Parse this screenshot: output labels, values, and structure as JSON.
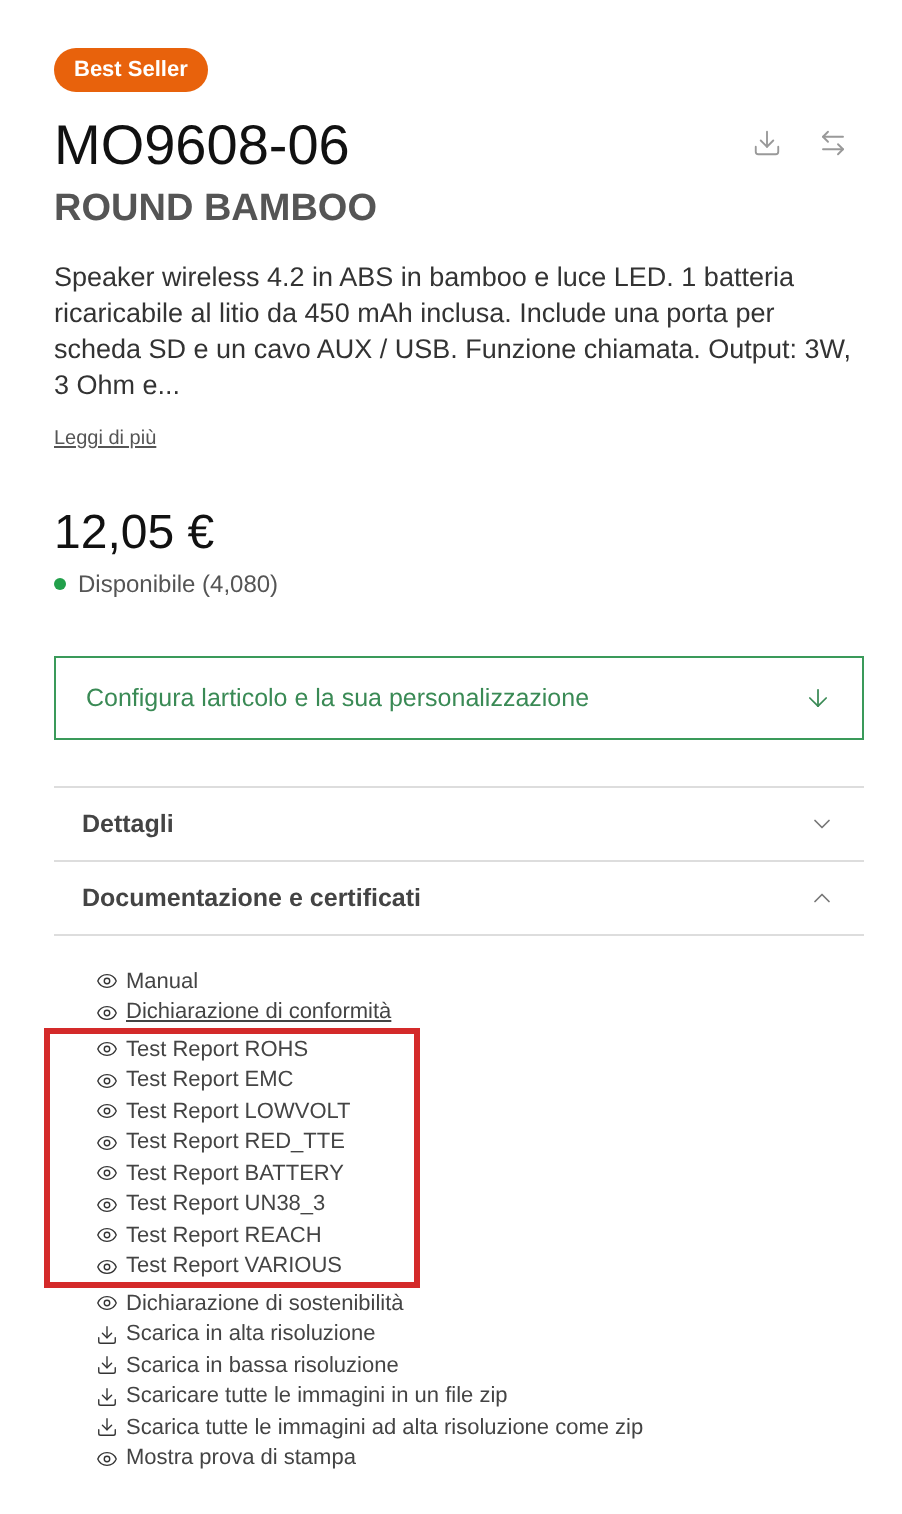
{
  "badge": "Best Seller",
  "product": {
    "code": "MO9608-06",
    "name": "ROUND BAMBOO",
    "description": "Speaker wireless 4.2 in ABS in bamboo e luce LED. 1 batteria ricaricabile al litio da 450 mAh inclusa. Include una porta per scheda SD e un cavo AUX / USB. Funzione chiamata. Output: 3W, 3 Ohm e...",
    "read_more": "Leggi di più"
  },
  "price": "12,05 €",
  "availability": {
    "text": "Disponibile (4,080)",
    "color": "#22a04b"
  },
  "configure": "Configura larticolo e la sua personalizzazione",
  "sections": [
    {
      "title": "Dettagli",
      "expanded": false
    },
    {
      "title": "Documentazione e certificati",
      "expanded": true
    }
  ],
  "document_groups": [
    {
      "kind": "plain",
      "items": [
        {
          "kind": "view",
          "label": "Manual",
          "hovered": false
        },
        {
          "kind": "view",
          "label": "Dichiarazione di conformità",
          "hovered": true
        }
      ]
    },
    {
      "kind": "highlighted",
      "items": [
        {
          "kind": "view",
          "label": "Test Report ROHS",
          "hovered": false
        },
        {
          "kind": "view",
          "label": "Test Report EMC",
          "hovered": false
        },
        {
          "kind": "view",
          "label": "Test Report LOWVOLT",
          "hovered": false
        },
        {
          "kind": "view",
          "label": "Test Report RED_TTE",
          "hovered": false
        },
        {
          "kind": "view",
          "label": "Test Report BATTERY",
          "hovered": false
        },
        {
          "kind": "view",
          "label": "Test Report UN38_3",
          "hovered": false
        },
        {
          "kind": "view",
          "label": "Test Report REACH",
          "hovered": false
        },
        {
          "kind": "view",
          "label": "Test Report VARIOUS",
          "hovered": false
        }
      ]
    },
    {
      "kind": "plain",
      "items": [
        {
          "kind": "view",
          "label": "Dichiarazione di sostenibilità",
          "hovered": false
        },
        {
          "kind": "download",
          "label": "Scarica in alta risoluzione",
          "hovered": false
        },
        {
          "kind": "download",
          "label": "Scarica in bassa risoluzione",
          "hovered": false
        },
        {
          "kind": "download",
          "label": "Scaricare tutte le immagini in un file zip",
          "hovered": false
        },
        {
          "kind": "download",
          "label": "Scarica tutte le immagini ad alta risoluzione come zip",
          "hovered": false
        },
        {
          "kind": "view",
          "label": "Mostra prova di stampa",
          "hovered": false
        }
      ]
    }
  ]
}
